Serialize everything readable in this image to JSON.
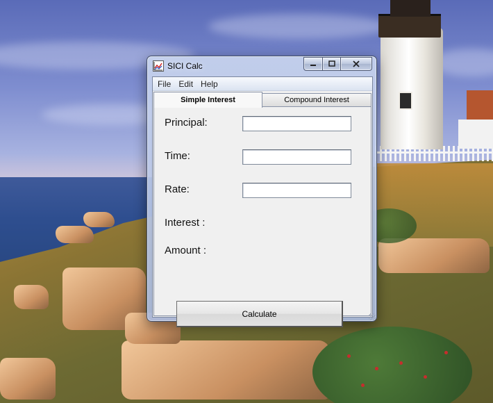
{
  "window": {
    "title": "SICI Calc",
    "icon": "chart-icon"
  },
  "menubar": {
    "items": [
      "File",
      "Edit",
      "Help"
    ]
  },
  "tabs": [
    {
      "label": "Simple Interest",
      "active": true
    },
    {
      "label": "Compound Interest",
      "active": false
    }
  ],
  "form": {
    "principal_label": "Principal:",
    "principal_value": "",
    "time_label": "Time:",
    "time_value": "",
    "rate_label": "Rate:",
    "rate_value": "",
    "interest_label": "Interest :",
    "amount_label": "Amount :",
    "calculate_label": "Calculate"
  },
  "colors": {
    "accent": "#c8d4ee",
    "panel": "#f0f0f0"
  }
}
